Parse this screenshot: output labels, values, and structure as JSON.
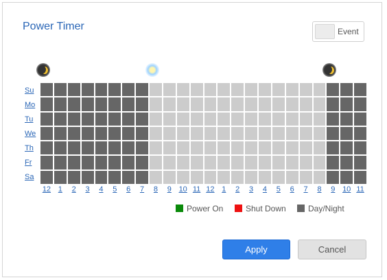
{
  "dialog": {
    "title": "Power Timer"
  },
  "event_toggle": {
    "label": "Event"
  },
  "days": [
    "Su",
    "Mo",
    "Tu",
    "We",
    "Th",
    "Fr",
    "Sa"
  ],
  "hours": [
    "12",
    "1",
    "2",
    "3",
    "4",
    "5",
    "6",
    "7",
    "8",
    "9",
    "10",
    "11",
    "12",
    "1",
    "2",
    "3",
    "4",
    "5",
    "6",
    "7",
    "8",
    "9",
    "10",
    "11"
  ],
  "schedule": {
    "night_hours": [
      0,
      1,
      2,
      3,
      4,
      5,
      6,
      7,
      21,
      22,
      23
    ],
    "day_hours": [
      8,
      9,
      10,
      11,
      12,
      13,
      14,
      15,
      16,
      17,
      18,
      19,
      20
    ]
  },
  "legend": [
    {
      "label": "Power On",
      "color": "#0a8a0a"
    },
    {
      "label": "Shut Down",
      "color": "#ee1111"
    },
    {
      "label": "Day/Night",
      "color": "#666666"
    }
  ],
  "buttons": {
    "apply": "Apply",
    "cancel": "Cancel"
  },
  "colors": {
    "accent": "#2f7fe8",
    "night_cell": "#666666",
    "day_cell": "#cccccc",
    "link": "#2a66b6"
  }
}
